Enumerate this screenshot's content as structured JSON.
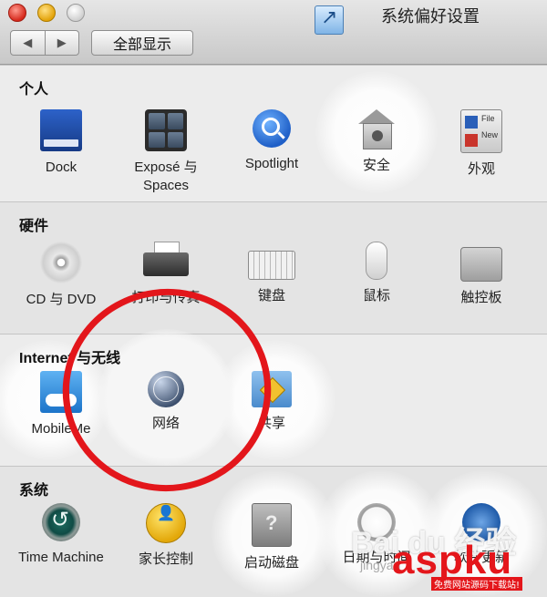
{
  "window": {
    "title": "系统偏好设置",
    "show_all_label": "全部显示",
    "back_glyph": "◀",
    "forward_glyph": "▶"
  },
  "sections": {
    "personal": {
      "title": "个人",
      "items": [
        {
          "label": "Dock",
          "icon": "dock-icon"
        },
        {
          "label": "Exposé 与 Spaces",
          "icon": "expose-spaces-icon"
        },
        {
          "label": "Spotlight",
          "icon": "spotlight-icon"
        },
        {
          "label": "安全",
          "icon": "security-icon"
        },
        {
          "label": "外观",
          "icon": "appearance-icon"
        }
      ],
      "appearance_icon_text": [
        "File",
        "New"
      ]
    },
    "hardware": {
      "title": "硬件",
      "items": [
        {
          "label": "CD 与 DVD",
          "icon": "cd-dvd-icon"
        },
        {
          "label": "打印与传真",
          "icon": "printer-icon"
        },
        {
          "label": "键盘",
          "icon": "keyboard-icon"
        },
        {
          "label": "鼠标",
          "icon": "mouse-icon"
        },
        {
          "label": "触控板",
          "icon": "trackpad-icon"
        }
      ]
    },
    "internet": {
      "title": "Internet 与无线",
      "items": [
        {
          "label": "MobileMe",
          "icon": "mobileme-icon"
        },
        {
          "label": "网络",
          "icon": "network-icon"
        },
        {
          "label": "共享",
          "icon": "sharing-icon"
        }
      ]
    },
    "system": {
      "title": "系统",
      "items": [
        {
          "label": "Time Machine",
          "icon": "time-machine-icon"
        },
        {
          "label": "家长控制",
          "icon": "parental-controls-icon"
        },
        {
          "label": "启动磁盘",
          "icon": "startup-disk-icon"
        },
        {
          "label": "日期与时间",
          "icon": "date-time-icon"
        },
        {
          "label": "软件更新",
          "icon": "software-update-icon"
        }
      ]
    }
  },
  "watermarks": {
    "baidu": "Bai du 经验",
    "jingyan": "jingyan",
    "aspku": "aspku",
    "aspku_sub": "免费网站源码下载站!"
  },
  "colors": {
    "annotation": "#e3161b"
  }
}
